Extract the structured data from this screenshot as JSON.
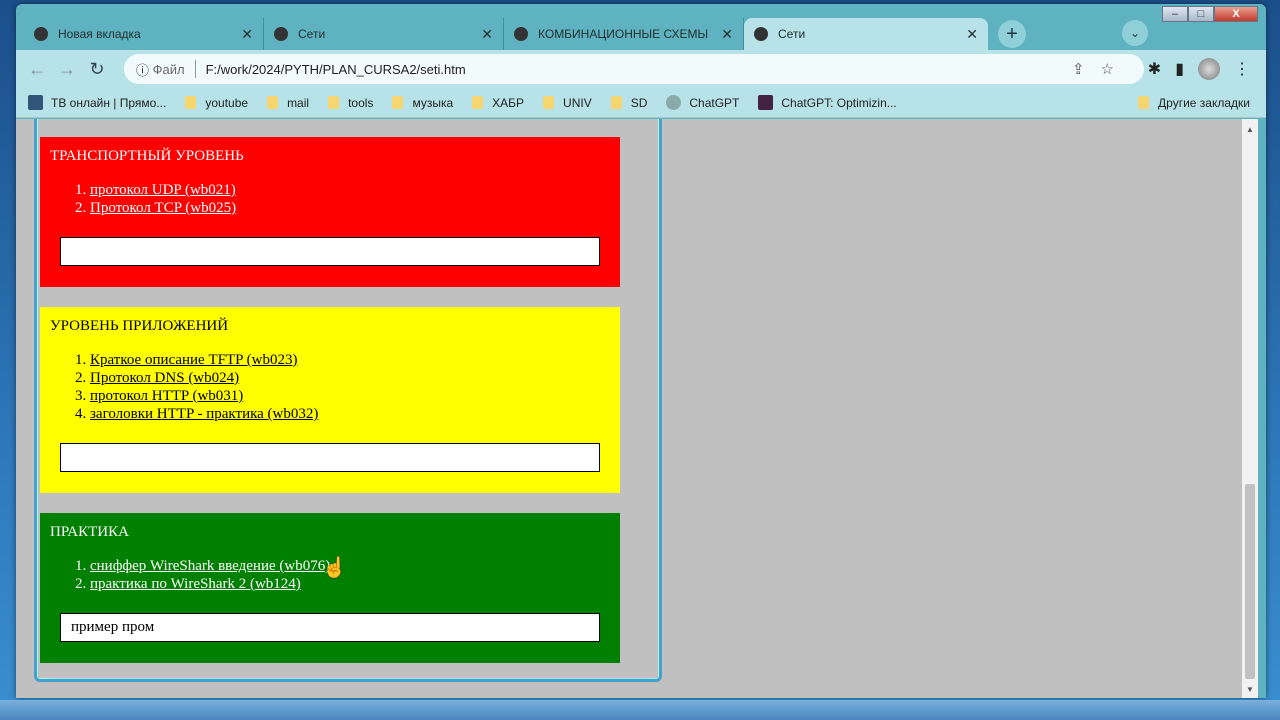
{
  "window": {
    "minimize": "–",
    "maximize": "□",
    "close": "X"
  },
  "tabs": [
    {
      "label": "Новая вкладка",
      "icon": "chrome-icon"
    },
    {
      "label": "Сети",
      "icon": "globe-icon"
    },
    {
      "label": "КОМБИНАЦИОННЫЕ СХЕМЫ",
      "icon": "globe-icon"
    },
    {
      "label": "Сети",
      "icon": "globe-icon",
      "active": true
    }
  ],
  "tab_close": "✕",
  "new_tab": "+",
  "tab_search": "⌄",
  "address": {
    "scheme": "Файл",
    "url": "F:/work/2024/PYTH/PLAN_CURSA2/seti.htm"
  },
  "bookmarks": [
    "ТВ онлайн | Прямо...",
    "youtube",
    "mail",
    "tools",
    "музыка",
    "ХАБР",
    "UNIV",
    "SD",
    "ChatGPT",
    "ChatGPT: Optimizin..."
  ],
  "other_bookmarks": "Другие закладки",
  "sections": [
    {
      "title": "ТРАНСПОРТНЫЙ УРОВЕНЬ",
      "color": "#ff0000",
      "links": [
        "протокол UDP (wb021)",
        "Протокол TCP (wb025)"
      ],
      "input": ""
    },
    {
      "title": "УРОВЕНЬ ПРИЛОЖЕНИЙ",
      "color": "#ffff00",
      "links": [
        "Краткое описание TFTP (wb023)",
        "Протокол DNS (wb024)",
        "протокол HTTP (wb031)",
        "заголовки HTTP - практика (wb032)"
      ],
      "input": ""
    },
    {
      "title": "ПРАКТИКА",
      "color": "#008000",
      "links": [
        "сниффер WireShark введение (wb076)",
        "практика по WireShark 2 (wb124)"
      ],
      "input": "пример пром"
    }
  ]
}
